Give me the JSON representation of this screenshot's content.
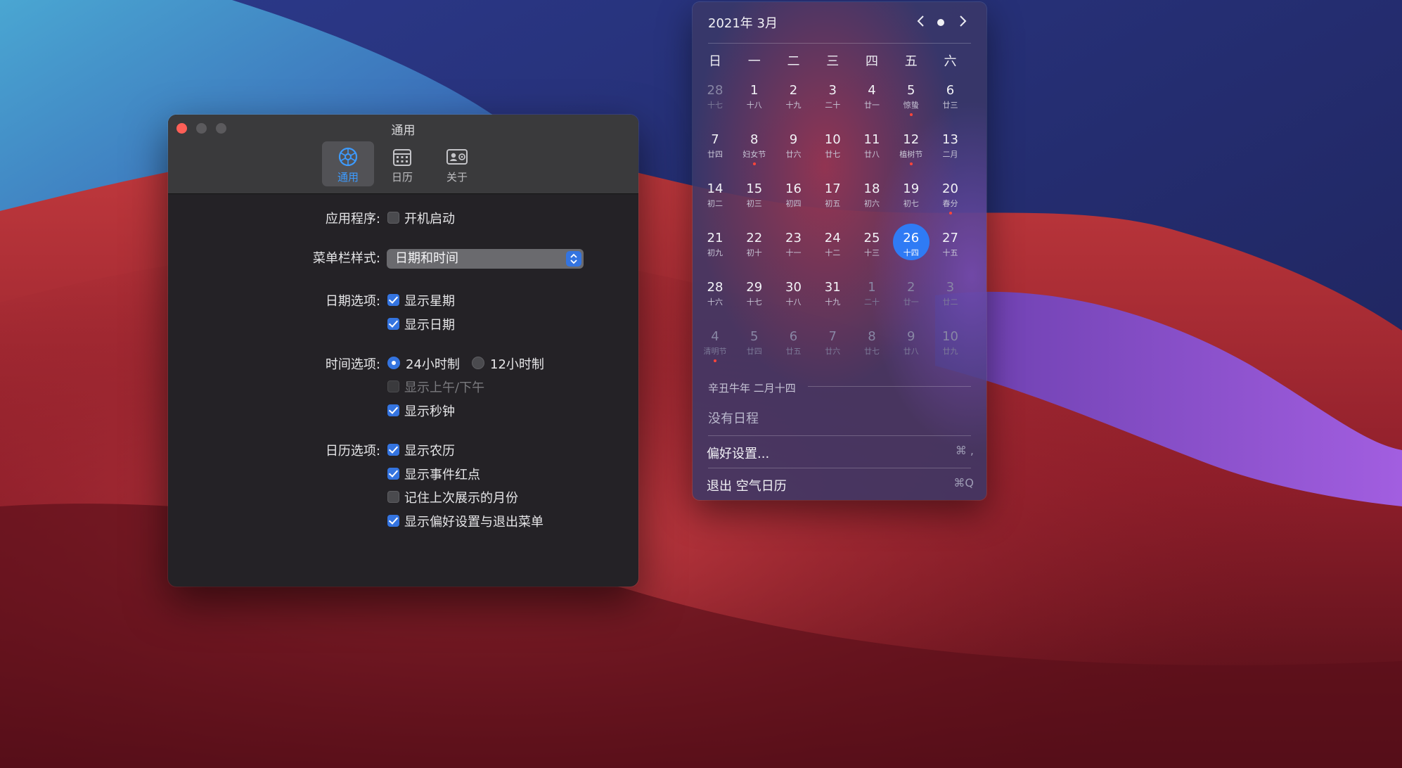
{
  "preferences_window": {
    "title": "通用",
    "toolbar": [
      {
        "label": "通用",
        "icon": "gear-icon",
        "active": true
      },
      {
        "label": "日历",
        "icon": "calendar-icon",
        "active": false
      },
      {
        "label": "关于",
        "icon": "contact-card-icon",
        "active": false
      }
    ],
    "app": {
      "label": "应用程序:",
      "launch_at_login": "开机启动",
      "launch_at_login_checked": false
    },
    "menubar_style": {
      "label": "菜单栏样式:",
      "value": "日期和时间"
    },
    "date_options": {
      "label": "日期选项:",
      "show_weekday": "显示星期",
      "show_date": "显示日期"
    },
    "time_options": {
      "label": "时间选项:",
      "h24": "24小时制",
      "h12": "12小时制",
      "show_ampm": "显示上午/下午",
      "show_seconds": "显示秒钟"
    },
    "calendar_options": {
      "label": "日历选项:",
      "show_lunar": "显示农历",
      "show_event_dots": "显示事件红点",
      "remember_month": "记住上次展示的月份",
      "show_pref_quit": "显示偏好设置与退出菜单"
    }
  },
  "calendar_popover": {
    "title": "2021年 3月",
    "weekdays": [
      "日",
      "一",
      "二",
      "三",
      "四",
      "五",
      "六"
    ],
    "days": [
      {
        "d": "28",
        "l": "十七",
        "other": true
      },
      {
        "d": "1",
        "l": "十八"
      },
      {
        "d": "2",
        "l": "十九"
      },
      {
        "d": "3",
        "l": "二十"
      },
      {
        "d": "4",
        "l": "廿一"
      },
      {
        "d": "5",
        "l": "惊蛰",
        "event": true
      },
      {
        "d": "6",
        "l": "廿三"
      },
      {
        "d": "7",
        "l": "廿四"
      },
      {
        "d": "8",
        "l": "妇女节",
        "event": true
      },
      {
        "d": "9",
        "l": "廿六"
      },
      {
        "d": "10",
        "l": "廿七"
      },
      {
        "d": "11",
        "l": "廿八"
      },
      {
        "d": "12",
        "l": "植树节",
        "event": true
      },
      {
        "d": "13",
        "l": "二月"
      },
      {
        "d": "14",
        "l": "初二"
      },
      {
        "d": "15",
        "l": "初三"
      },
      {
        "d": "16",
        "l": "初四"
      },
      {
        "d": "17",
        "l": "初五"
      },
      {
        "d": "18",
        "l": "初六"
      },
      {
        "d": "19",
        "l": "初七"
      },
      {
        "d": "20",
        "l": "春分",
        "event": true
      },
      {
        "d": "21",
        "l": "初九"
      },
      {
        "d": "22",
        "l": "初十"
      },
      {
        "d": "23",
        "l": "十一"
      },
      {
        "d": "24",
        "l": "十二"
      },
      {
        "d": "25",
        "l": "十三"
      },
      {
        "d": "26",
        "l": "十四",
        "today": true
      },
      {
        "d": "27",
        "l": "十五"
      },
      {
        "d": "28",
        "l": "十六"
      },
      {
        "d": "29",
        "l": "十七"
      },
      {
        "d": "30",
        "l": "十八"
      },
      {
        "d": "31",
        "l": "十九"
      },
      {
        "d": "1",
        "l": "二十",
        "other": true
      },
      {
        "d": "2",
        "l": "廿一",
        "other": true
      },
      {
        "d": "3",
        "l": "廿二",
        "other": true
      },
      {
        "d": "4",
        "l": "清明节",
        "other": true,
        "event": true
      },
      {
        "d": "5",
        "l": "廿四",
        "other": true
      },
      {
        "d": "6",
        "l": "廿五",
        "other": true
      },
      {
        "d": "7",
        "l": "廿六",
        "other": true
      },
      {
        "d": "8",
        "l": "廿七",
        "other": true
      },
      {
        "d": "9",
        "l": "廿八",
        "other": true
      },
      {
        "d": "10",
        "l": "廿九",
        "other": true
      }
    ],
    "selected_lunar": "辛丑牛年 二月十四",
    "no_events": "没有日程",
    "preferences": {
      "label": "偏好设置...",
      "shortcut": "⌘ ,"
    },
    "quit": {
      "label": "退出 空气日历",
      "shortcut": "⌘Q"
    }
  },
  "colors": {
    "accent": "#3474e0",
    "today": "#2f7bf5",
    "event_dot": "#ff453a",
    "close": "#fe5f57"
  }
}
